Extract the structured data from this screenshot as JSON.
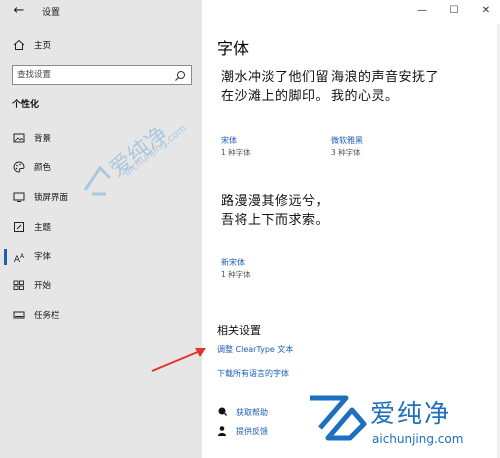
{
  "window": {
    "title": "设置",
    "back_icon": "arrow-left-icon",
    "controls": {
      "minimize": "—",
      "maximize": "☐",
      "close": "✕"
    }
  },
  "sidebar": {
    "home": {
      "label": "主页",
      "icon": "home-icon"
    },
    "search": {
      "placeholder": "查找设置",
      "icon": "search-icon"
    },
    "section": "个性化",
    "items": [
      {
        "label": "背景",
        "icon": "picture-icon",
        "active": false
      },
      {
        "label": "颜色",
        "icon": "palette-icon",
        "active": false
      },
      {
        "label": "锁屏界面",
        "icon": "monitor-lock-icon",
        "active": false
      },
      {
        "label": "主题",
        "icon": "brush-icon",
        "active": false
      },
      {
        "label": "字体",
        "icon": "font-icon",
        "active": true
      },
      {
        "label": "开始",
        "icon": "start-grid-icon",
        "active": false
      },
      {
        "label": "任务栏",
        "icon": "taskbar-icon",
        "active": false
      }
    ]
  },
  "main": {
    "title": "字体",
    "fonts": [
      {
        "preview": "潮水冲淡了他们留在沙滩上的脚印。",
        "name": "宋体",
        "count": "1 种字体"
      },
      {
        "preview": "海浪的声音安抚了我的心灵。",
        "name": "微软雅黑",
        "count": "3 种字体"
      },
      {
        "preview": "路漫漫其修远兮，吾将上下而求索。",
        "name": "新宋体",
        "count": "1 种字体"
      }
    ],
    "related": {
      "title": "相关设置",
      "links": [
        "调整 ClearType 文本",
        "下载所有语言的字体"
      ]
    },
    "help": [
      {
        "label": "获取帮助",
        "icon": "help-chat-icon"
      },
      {
        "label": "提供反馈",
        "icon": "feedback-person-icon"
      }
    ]
  },
  "watermark": {
    "brand_cn": "爱纯净",
    "brand_url": "aichunjing.com",
    "color": "#1e6fbf"
  },
  "colors": {
    "sidebar_bg": "#e6e6e6",
    "accent": "#1a5fb4",
    "selection_bar": "#1f5fb0",
    "annotation_arrow": "#e0332a"
  }
}
